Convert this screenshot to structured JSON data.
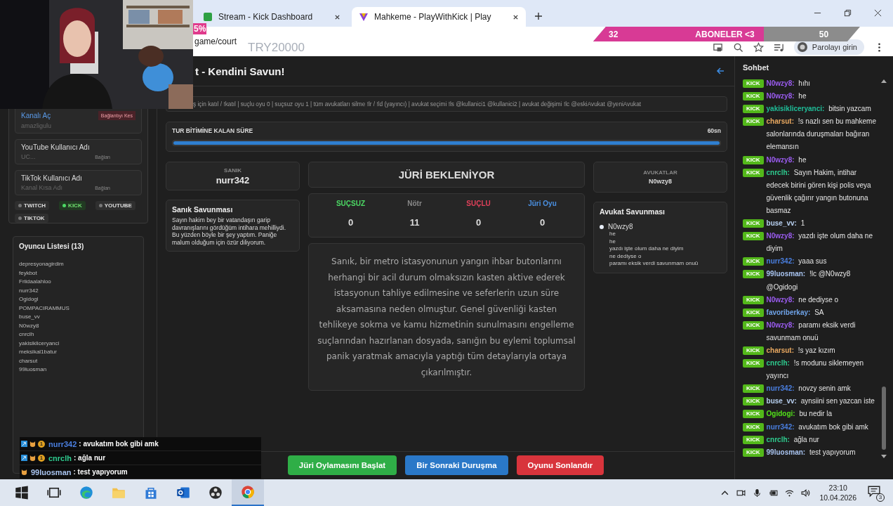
{
  "browser": {
    "tabs": [
      {
        "title": "Stream - Kick Dashboard",
        "selected": false
      },
      {
        "title": "Mahkeme - PlayWithKick | Play",
        "selected": true
      }
    ],
    "address": "game/court",
    "profile_button": "Parolayı girin"
  },
  "overlays": {
    "percent_label": "5%",
    "promo_code": "TRY20000",
    "sub_goal": {
      "current": "32",
      "label": "ABONELER <3",
      "target": "50",
      "level": 0.64
    },
    "stream_chat": [
      {
        "sub_badge": "1",
        "name": "nurr342",
        "color": "#4a7fe0",
        "text": ": avukatım bok gibi amk"
      },
      {
        "sub_badge": "1",
        "name": "cnrclh",
        "color": "#2ecc8f",
        "text": ": ağla nur"
      },
      {
        "name": "99luosman",
        "color": "#a9c4f0",
        "text": ": test yapıyorum"
      }
    ]
  },
  "sidebar": {
    "kick_card": {
      "link": "Kanalı Aç",
      "value": "amazligulu",
      "button": "Bağlantıyı Kes"
    },
    "fields": [
      {
        "label": "YouTube Kullanıcı Adı",
        "placeholder": "UC...",
        "button": "Bağlan"
      },
      {
        "label": "TikTok Kullanıcı Adı",
        "placeholder": "Kanal Kısa Adı",
        "button": "Bağlan"
      }
    ],
    "platforms": [
      {
        "label": "TWITCH",
        "on": false
      },
      {
        "label": "KICK",
        "on": true
      },
      {
        "label": "YOUTUBE",
        "on": false
      },
      {
        "label": "TIKTOK",
        "on": false
      }
    ],
    "player_list": {
      "title": "Oyuncu Listesi (13)",
      "players": [
        "depresyonagirdim",
        "feykbot",
        "Friidaalahloo",
        "nurr342",
        "Ogidogi",
        "POMPACIRAMMUS",
        "buse_vv",
        "N0wzy8",
        "cnrclh",
        "yakisikliceryanci",
        "meksikal1batur",
        "charsut",
        "99luosman"
      ]
    }
  },
  "court": {
    "title": "t - Kendini Savun!",
    "commands": "ş için katıl / !katıl | suçlu oyu 0 | suçsuz oyu 1 | tüm avukatları silme !lr / !ld (yayıncı) | avukat seçimi !ls @kullanici1 @kullanici2 | avukat değişimi !lc @eskiAvukat @yeniAvukat",
    "timer": {
      "label": "TUR BİTİMİNE KALAN SÜRE",
      "value": "60sn",
      "level": 1
    },
    "defendant": {
      "label": "SANIK",
      "name": "nurr342"
    },
    "defense": {
      "title": "Sanık Savunması",
      "text": "Sayın hakim bey bir vatandaşın garip davranışlarını gördüğüm intihara mehilliydi. Bu yüzden böyle bir şey yaptım. Paniğe malum olduğum için özür diliyorum."
    },
    "status": "JÜRİ BEKLENİYOR",
    "votes": [
      {
        "label": "SUÇSUZ",
        "value": "0",
        "color": "#4cd964"
      },
      {
        "label": "Nötr",
        "value": "11",
        "color": "#8a8a8a"
      },
      {
        "label": "SUÇLU",
        "value": "0",
        "color": "#e0405a"
      },
      {
        "label": "Jüri Oyu",
        "value": "0",
        "color": "#4a90e2"
      }
    ],
    "accusation": "Sanık, bir metro istasyonunun yangın ihbar butonlarını herhangi bir acil durum olmaksızın kasten aktive ederek istasyonun tahliye edilmesine ve seferlerin uzun süre aksamasına neden olmuştur. Genel güvenliği kasten tehlikeye sokma ve kamu hizmetinin sunulmasını engelleme suçlarından hazırlanan dosyada, sanığın bu eylemi toplumsal panik yaratmak amacıyla yaptığı tüm detaylarıyla ortaya çıkarılmıştır.",
    "lawyers": {
      "label": "AVUKATLAR",
      "name": "N0wzy8"
    },
    "lawyer_defense": {
      "title": "Avukat Savunması",
      "name": "N0wzy8",
      "lines": [
        "he",
        "he",
        "yazdı işte olum daha ne diyim",
        "ne dediyse o",
        "paramı eksik verdi savunmam onuü"
      ]
    },
    "buttons": [
      {
        "label": "Jüri Oylamasını Başlat",
        "kind": "start"
      },
      {
        "label": "Bir Sonraki Duruşma",
        "kind": "next"
      },
      {
        "label": "Oyunu Sonlandır",
        "kind": "end"
      }
    ]
  },
  "chat": {
    "title": "Sohbet",
    "messages": [
      {
        "badge": "KICK",
        "name": "N0wzy8:",
        "color": "#9b5cf0",
        "text": "hıhı"
      },
      {
        "badge": "KICK",
        "name": "N0wzy8:",
        "color": "#9b5cf0",
        "text": "he"
      },
      {
        "badge": "KICK",
        "name": "yakisikliceryanci:",
        "color": "#1fbf9a",
        "text": "bitsin yazcam"
      },
      {
        "badge": "KICK",
        "name": "charsut:",
        "color": "#e8a860",
        "text": "!s nazlı sen bu mahkeme salonlarında duruşmaları bağıran elemansın"
      },
      {
        "badge": "KICK",
        "name": "N0wzy8:",
        "color": "#9b5cf0",
        "text": "he"
      },
      {
        "badge": "KICK",
        "name": "cnrclh:",
        "color": "#2ecc8f",
        "text": "Sayın Hakim, intihar edecek birini gören kişi polis veya güvenlik çağırır yangın butonuna basmaz"
      },
      {
        "badge": "KICK",
        "name": "buse_vv:",
        "color": "#b8d0f0",
        "text": "1"
      },
      {
        "badge": "KICK",
        "name": "N0wzy8:",
        "color": "#9b5cf0",
        "text": "yazdı işte olum daha ne diyim"
      },
      {
        "badge": "KICK",
        "name": "nurr342:",
        "color": "#4a7fe0",
        "text": "yaaa sus"
      },
      {
        "badge": "KICK",
        "name": "99luosman:",
        "color": "#a9c4f0",
        "text": "!lc @N0wzy8 @Ogidogi"
      },
      {
        "badge": "KICK",
        "name": "N0wzy8:",
        "color": "#9b5cf0",
        "text": "ne dediyse o"
      },
      {
        "badge": "KICK",
        "name": "favoriberkay:",
        "color": "#6fa3e8",
        "text": "SA"
      },
      {
        "badge": "KICK",
        "name": "N0wzy8:",
        "color": "#9b5cf0",
        "text": "paramı eksik verdi savunmam onuü"
      },
      {
        "badge": "KICK",
        "name": "charsut:",
        "color": "#e8a860",
        "text": "!s yaz kızım"
      },
      {
        "badge": "KICK",
        "name": "cnrclh:",
        "color": "#2ecc8f",
        "text": "!s modunu siklemeyen yayıncı"
      },
      {
        "badge": "KICK",
        "name": "nurr342:",
        "color": "#4a7fe0",
        "text": "novzy senin amk"
      },
      {
        "badge": "KICK",
        "name": "buse_vv:",
        "color": "#b8d0f0",
        "text": "aynsiini sen yazcan iste"
      },
      {
        "badge": "KICK",
        "name": "Ogidogi:",
        "color": "#53e01a",
        "text": "bu nedir la"
      },
      {
        "badge": "KICK",
        "name": "nurr342:",
        "color": "#4a7fe0",
        "text": "avukatım bok gibi amk"
      },
      {
        "badge": "KICK",
        "name": "cnrclh:",
        "color": "#2ecc8f",
        "text": "ağla nur"
      },
      {
        "badge": "KICK",
        "name": "99luosman:",
        "color": "#a9c4f0",
        "text": "test yapıyorum"
      }
    ]
  },
  "taskbar": {
    "time": "23:10",
    "date": "10.04.2026",
    "notifications": "3"
  }
}
